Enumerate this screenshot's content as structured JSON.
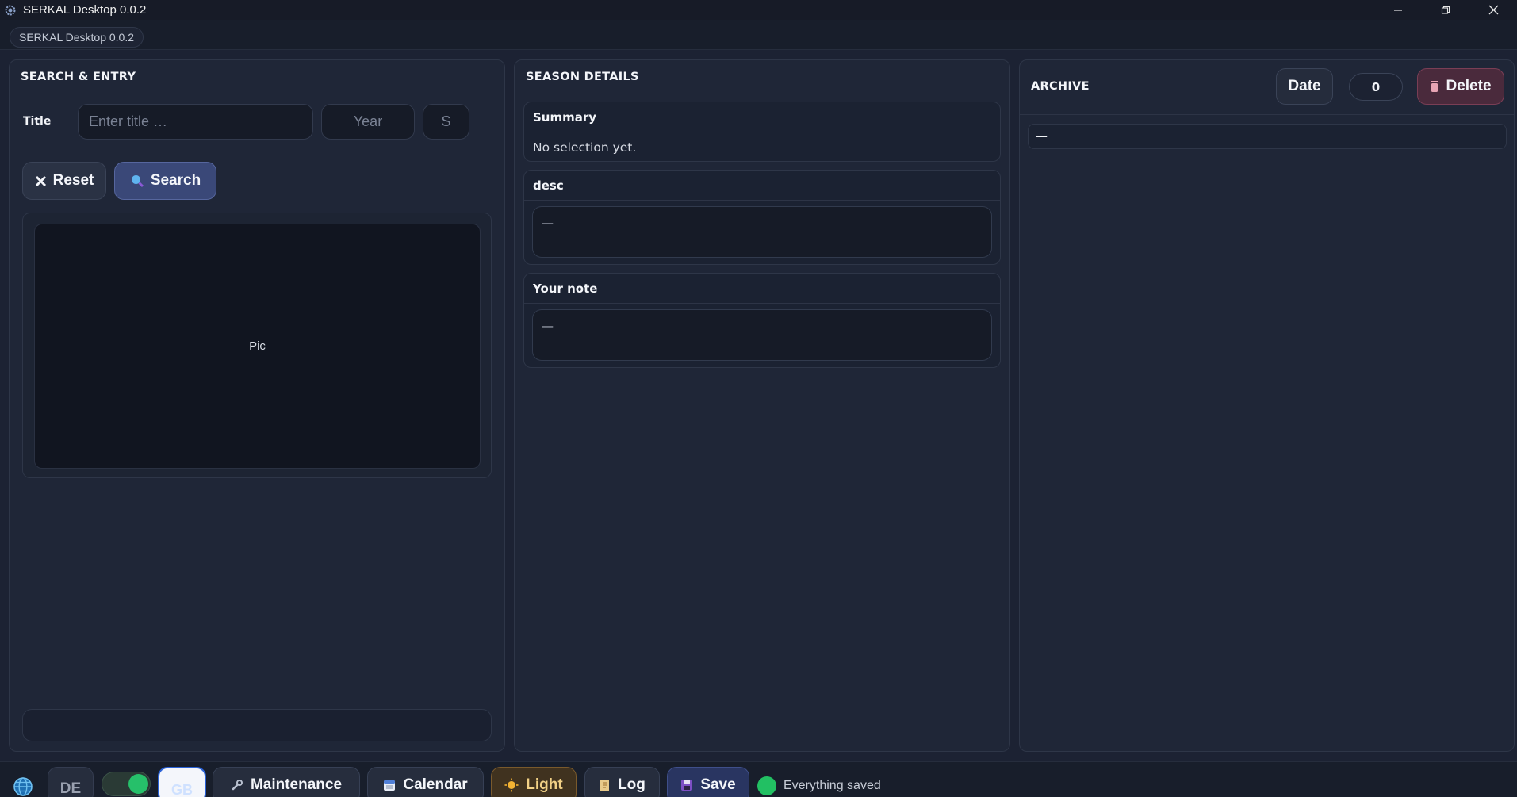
{
  "window": {
    "title": "SERKAL Desktop 0.0.2"
  },
  "tab": {
    "label": "SERKAL Desktop 0.0.2"
  },
  "search_panel": {
    "title": "SEARCH & ENTRY",
    "title_label": "Title",
    "title_placeholder": "Enter title …",
    "year_placeholder": "Year",
    "season_placeholder": "S",
    "reset_label": "Reset",
    "search_label": "Search",
    "pic_label": "Pic"
  },
  "season_panel": {
    "title": "SEASON DETAILS",
    "summary_title": "Summary",
    "summary_text": "No selection yet.",
    "desc_title": "desc",
    "desc_value": "—",
    "note_title": "Your note",
    "note_value": "—"
  },
  "archive_panel": {
    "title": "ARCHIVE",
    "date_label": "Date",
    "count": "0",
    "delete_label": "Delete",
    "row_value": "—"
  },
  "statusbar": {
    "lang_de": "DE",
    "lang_gb": "GB",
    "maintenance_label": "Maintenance",
    "calendar_label": "Calendar",
    "light_label": "Light",
    "log_label": "Log",
    "save_label": "Save",
    "status_text": "Everything saved"
  },
  "colors": {
    "background": "#1c2233",
    "panel": "#1f2637",
    "search_button": "#3a4878",
    "delete_button": "#4a2a3c",
    "status_ok": "#22c063"
  }
}
